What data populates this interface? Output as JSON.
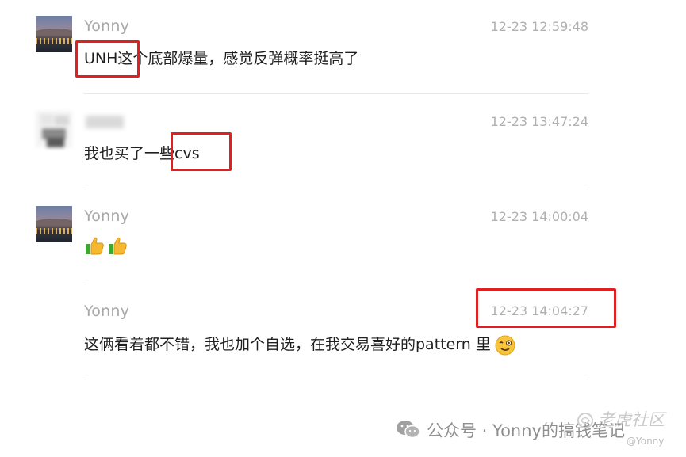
{
  "messages": [
    {
      "user": "Yonny",
      "time": "12-23 12:59:48",
      "text": "UNH这个底部爆量，感觉反弹概率挺高了"
    },
    {
      "user": "",
      "time": "12-23 13:47:24",
      "text": "我也买了一些cvs"
    },
    {
      "user": "Yonny",
      "time": "12-23 14:00:04",
      "emoji": [
        "thumbs-up",
        "thumbs-up"
      ]
    },
    {
      "user": "Yonny",
      "time": "12-23 14:04:27",
      "text": "这俩看着都不错，我也加个自选，在我交易喜好的pattern 里",
      "emoji": "wink-face"
    }
  ],
  "watermark": {
    "source": "公众号 · Yonny的搞钱笔记",
    "community": "老虎社区",
    "handle": "@Yonny"
  },
  "colors": {
    "highlight_box": "#e02020",
    "username": "#a8a8a8",
    "timestamp": "#b0b0b0",
    "text": "#1f1f1f",
    "divider": "#e8e8e8"
  }
}
